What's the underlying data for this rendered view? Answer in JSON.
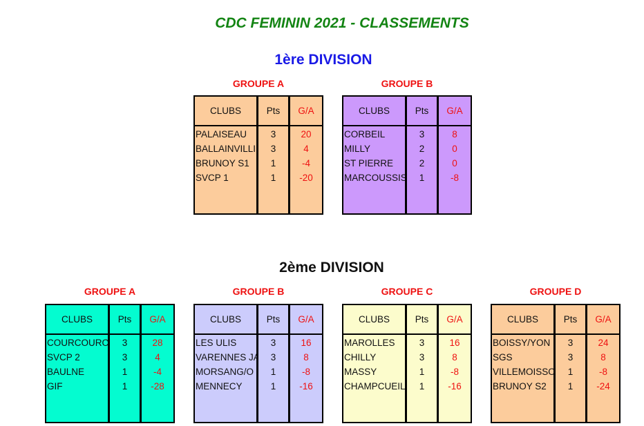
{
  "page": {
    "title": "CDC FEMININ 2021 - CLASSEMENTS"
  },
  "divisions": [
    {
      "title": "1ère DIVISION",
      "groups": [
        {
          "label": "GROUPE A",
          "color": "#fccc9c",
          "headers": {
            "clubs": "CLUBS",
            "pts": "Pts",
            "ga": "G/A"
          },
          "rows": [
            {
              "club": "PALAISEAU",
              "pts": "3",
              "ga": "20"
            },
            {
              "club": "BALLAINVILLIE",
              "pts": "3",
              "ga": "4"
            },
            {
              "club": "BRUNOY S1",
              "pts": "1",
              "ga": "-4"
            },
            {
              "club": "SVCP 1",
              "pts": "1",
              "ga": "-20"
            }
          ]
        },
        {
          "label": "GROUPE B",
          "color": "#cc99fc",
          "headers": {
            "clubs": "CLUBS",
            "pts": "Pts",
            "ga": "G/A"
          },
          "rows": [
            {
              "club": "CORBEIL",
              "pts": "3",
              "ga": "8"
            },
            {
              "club": "MILLY",
              "pts": "2",
              "ga": "0"
            },
            {
              "club": "ST PIERRE",
              "pts": "2",
              "ga": "0"
            },
            {
              "club": "MARCOUSSIS",
              "pts": "1",
              "ga": "-8"
            }
          ]
        }
      ]
    },
    {
      "title": "2ème DIVISION",
      "groups": [
        {
          "label": "GROUPE A",
          "color": "#04fcd0",
          "headers": {
            "clubs": "CLUBS",
            "pts": "Pts",
            "ga": "G/A"
          },
          "rows": [
            {
              "club": "COURCOURONNES",
              "pts": "3",
              "ga": "28"
            },
            {
              "club": "SVCP 2",
              "pts": "3",
              "ga": "4"
            },
            {
              "club": "BAULNE",
              "pts": "1",
              "ga": "-4"
            },
            {
              "club": "GIF",
              "pts": "1",
              "ga": "-28"
            }
          ]
        },
        {
          "label": "GROUPE B",
          "color": "#ccccfc",
          "headers": {
            "clubs": "CLUBS",
            "pts": "Pts",
            "ga": "G/A"
          },
          "rows": [
            {
              "club": "LES ULIS",
              "pts": "3",
              "ga": "16"
            },
            {
              "club": "VARENNES JA",
              "pts": "3",
              "ga": "8"
            },
            {
              "club": "MORSANG/O",
              "pts": "1",
              "ga": "-8"
            },
            {
              "club": "MENNECY",
              "pts": "1",
              "ga": "-16"
            }
          ]
        },
        {
          "label": "GROUPE C",
          "color": "#fcfccc",
          "headers": {
            "clubs": "CLUBS",
            "pts": "Pts",
            "ga": "G/A"
          },
          "rows": [
            {
              "club": "MAROLLES",
              "pts": "3",
              "ga": "16"
            },
            {
              "club": "CHILLY",
              "pts": "3",
              "ga": "8"
            },
            {
              "club": "MASSY",
              "pts": "1",
              "ga": "-8"
            },
            {
              "club": "CHAMPCUEIL",
              "pts": "1",
              "ga": "-16"
            }
          ]
        },
        {
          "label": "GROUPE D",
          "color": "#fccc9c",
          "headers": {
            "clubs": "CLUBS",
            "pts": "Pts",
            "ga": "G/A"
          },
          "rows": [
            {
              "club": "BOISSY/YON",
              "pts": "3",
              "ga": "24"
            },
            {
              "club": "SGS",
              "pts": "3",
              "ga": "8"
            },
            {
              "club": "VILLEMOISSON",
              "pts": "1",
              "ga": "-8"
            },
            {
              "club": "BRUNOY S2",
              "pts": "1",
              "ga": "-24"
            }
          ]
        }
      ]
    }
  ]
}
